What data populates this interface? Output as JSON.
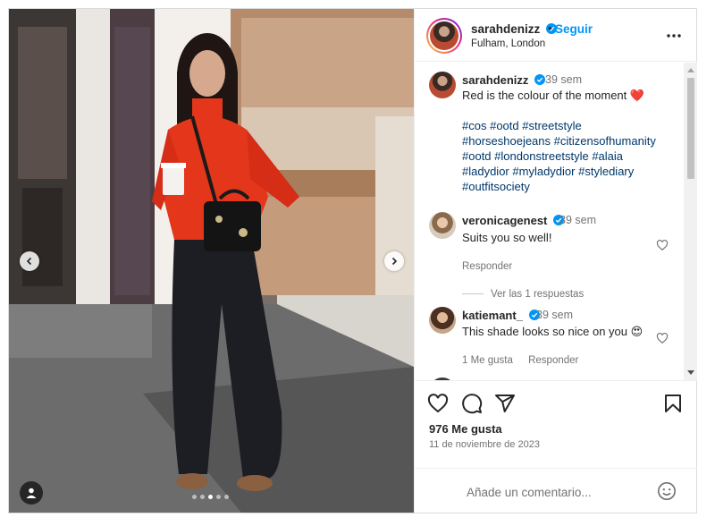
{
  "post": {
    "username": "sarahdenizz",
    "separator": "•",
    "follow_label": "Seguir",
    "location": "Fulham, London",
    "carousel": {
      "slide_count": 5,
      "active_slide": 3
    }
  },
  "caption": {
    "username": "sarahdenizz",
    "time": "39 sem",
    "text": "Red is the colour of the moment ❤️",
    "hashtags": [
      "#cos",
      "#ootd",
      "#streetstyle",
      "#horseshoejeans",
      "#citizensofhumanity",
      "#ootd",
      "#londonstreetstyle",
      "#alaia",
      "#ladydior",
      "#myladydior",
      "#stylediary",
      "#outfitsociety"
    ]
  },
  "comments": [
    {
      "username": "veronicagenest",
      "time": "39 sem",
      "text": "Suits you so well!",
      "reply_label": "Responder",
      "view_replies": "Ver las 1 respuestas"
    },
    {
      "username": "katiemant_",
      "time": "39 sem",
      "text": "This shade looks so nice on you 😍",
      "likes_label": "1 Me gusta",
      "reply_label": "Responder"
    }
  ],
  "stats": {
    "likes": "976 Me gusta",
    "date": "11 de noviembre de 2023"
  },
  "composer": {
    "placeholder": "Añade un comentario..."
  },
  "icons": [
    "verified-badge-icon",
    "more-options-icon",
    "heart-icon",
    "comment-icon",
    "share-icon",
    "bookmark-icon",
    "emoji-icon",
    "chevron-left-icon",
    "chevron-right-icon",
    "user-tag-icon"
  ],
  "colors": {
    "accent": "#0095f6",
    "hashtag": "#00376b",
    "muted": "#737373",
    "sweater": "#e4361b"
  }
}
